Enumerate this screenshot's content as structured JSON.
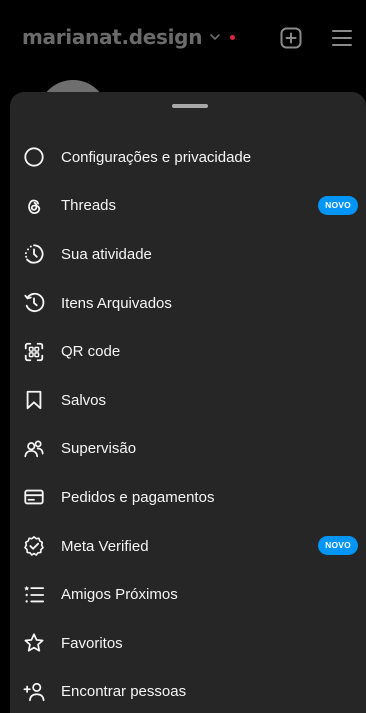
{
  "header": {
    "username": "marianat.design",
    "icons": [
      "chevron-down-icon",
      "notification-dot",
      "plus-square-icon",
      "hamburger-menu-icon"
    ]
  },
  "menu": {
    "items": [
      {
        "label": "Configurações e privacidade",
        "icon": "settings-icon"
      },
      {
        "label": "Threads",
        "icon": "threads-icon",
        "badge": "NOVO"
      },
      {
        "label": "Sua atividade",
        "icon": "activity-icon"
      },
      {
        "label": "Itens Arquivados",
        "icon": "archive-icon"
      },
      {
        "label": "QR code",
        "icon": "qr-code-icon"
      },
      {
        "label": "Salvos",
        "icon": "bookmark-icon"
      },
      {
        "label": "Supervisão",
        "icon": "supervision-icon"
      },
      {
        "label": "Pedidos e pagamentos",
        "icon": "card-icon"
      },
      {
        "label": "Meta Verified",
        "icon": "verified-icon",
        "badge": "NOVO"
      },
      {
        "label": "Amigos Próximos",
        "icon": "close-friends-icon"
      },
      {
        "label": "Favoritos",
        "icon": "star-icon"
      },
      {
        "label": "Encontrar pessoas",
        "icon": "add-person-icon"
      }
    ]
  },
  "colors": {
    "background": "#000000",
    "sheet": "#262626",
    "badge": "#0095f6",
    "notification_dot": "#e0243b",
    "text": "#f5f5f5"
  }
}
